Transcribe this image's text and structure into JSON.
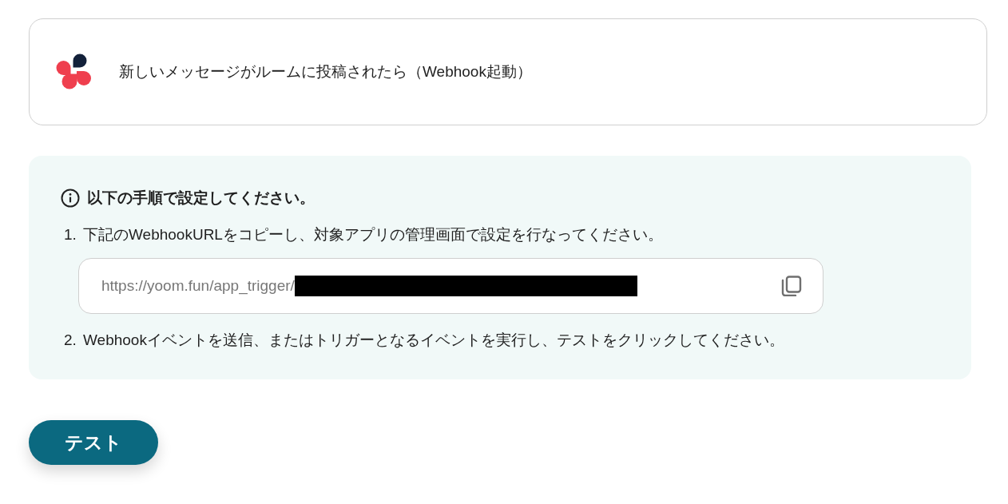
{
  "trigger": {
    "title": "新しいメッセージがルームに投稿されたら（Webhook起動）"
  },
  "instructions": {
    "heading": "以下の手順で設定してください。",
    "items": [
      {
        "kind": "step",
        "number": "1.",
        "text": "下記のWebhookURLをコピーし、対象アプリの管理画面で設定を行なってください。"
      },
      {
        "kind": "url_field",
        "value": "https://yoom.fun/app_trigger/"
      },
      {
        "kind": "step",
        "number": "2.",
        "text": "Webhookイベントを送信、またはトリガーとなるイベントを実行し、テストをクリックしてください。"
      }
    ]
  },
  "test_button": {
    "label": "テスト"
  }
}
